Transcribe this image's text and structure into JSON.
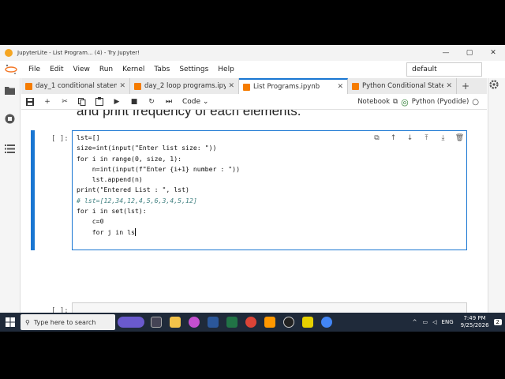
{
  "window": {
    "title": "JupyterLite - List Program... (4) - Try Jupyter!",
    "buttons": [
      "—",
      "▢",
      "✕"
    ]
  },
  "menu": {
    "items": [
      "File",
      "Edit",
      "View",
      "Run",
      "Kernel",
      "Tabs",
      "Settings",
      "Help"
    ],
    "kernel_dropdown": "default"
  },
  "tabs": [
    {
      "label": "day_1 conditional statemer",
      "active": false
    },
    {
      "label": "day_2 loop programs.ipynb",
      "active": false
    },
    {
      "label": "List Programs.ipynb",
      "active": true
    },
    {
      "label": "Python Conditional Statem",
      "active": false
    }
  ],
  "tab_add": "+",
  "toolbar": {
    "cell_type": "Code",
    "notebook_label": "Notebook",
    "kernel_label": "Python (Pyodide)"
  },
  "notebook": {
    "heading_fragment": "and print frequency of each elements.",
    "cell1": {
      "prompt": "[ ]:",
      "lines": [
        "lst=[]",
        "size=int(input(\"Enter list size: \"))",
        "for i in range(0, size, 1):",
        "    n=int(input(f\"Enter {i+1} number : \"))",
        "    lst.append(n)",
        "print(\"Entered List : \", lst)",
        "# lst=[12,34,12,4,5,6,3,4,5,12]",
        "for i in set(lst):",
        "    c=0",
        "    for j in ls"
      ]
    },
    "cell2": {
      "prompt": "[ ]:"
    }
  },
  "taskbar": {
    "search_placeholder": "Type here to search",
    "language": "ENG",
    "time": "7:49 PM",
    "date": "9/25/2026",
    "notification_count": "2"
  }
}
